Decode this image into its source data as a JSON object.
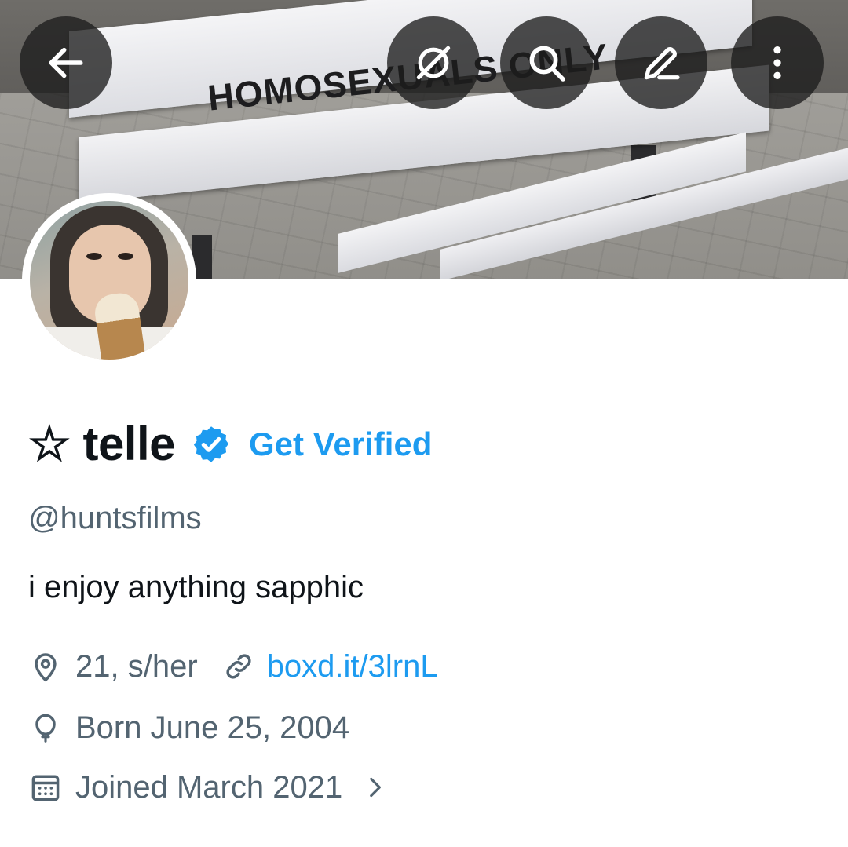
{
  "banner": {
    "sign_text": "HOMOSEXUALS ONLY"
  },
  "top_bar": {
    "icons": [
      "back-arrow-icon",
      "grok-icon",
      "search-icon",
      "edit-icon",
      "more-vertical-icon"
    ]
  },
  "profile": {
    "display_name": "☆ telle",
    "verified_badge_color": "#1d9bf0",
    "get_verified_label": "Get Verified",
    "handle": "@huntsfilms",
    "bio": "i enjoy anything sapphic",
    "location": "21, s/her",
    "website": "boxd.it/3lrnL",
    "birthday": "Born June 25, 2004",
    "joined": "Joined March 2021"
  },
  "colors": {
    "primary_text": "#0f1419",
    "secondary_text": "#536471",
    "accent": "#1d9bf0"
  }
}
